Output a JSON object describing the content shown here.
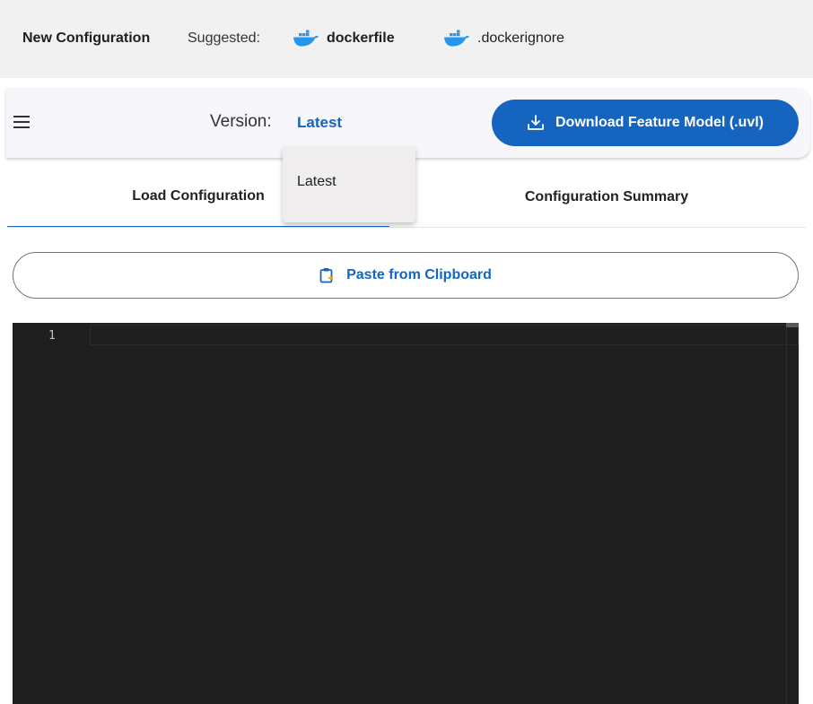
{
  "topbar": {
    "title": "New Configuration",
    "suggested_label": "Suggested:",
    "suggestions": [
      {
        "label": "dockerfile",
        "icon": "docker-icon"
      },
      {
        "label": ".dockerignore",
        "icon": "docker-icon"
      }
    ]
  },
  "header": {
    "version_label": "Version:",
    "version_value": "Latest",
    "download_label": "Download Feature Model (.uvl)"
  },
  "tabs": [
    {
      "label": "Load Configuration",
      "active": true
    },
    {
      "label": "Configuration Summary",
      "active": false
    }
  ],
  "paste_button": {
    "label": "Paste from Clipboard"
  },
  "editor": {
    "line_numbers": [
      "1"
    ]
  },
  "version_dropdown": {
    "options": [
      "Latest"
    ]
  },
  "colors": {
    "accent": "#1565c0",
    "docker_blue": "#2496ed",
    "editor_bg": "#1e1e1e",
    "topbar_bg": "#f1f1f1"
  }
}
